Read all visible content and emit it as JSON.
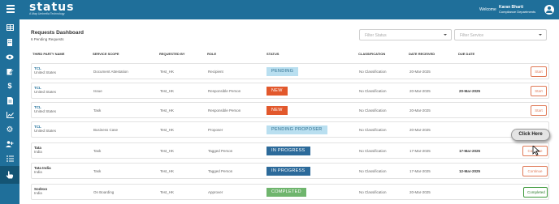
{
  "header": {
    "logo": "status",
    "logo_sub": "A Map Umbrella Technology",
    "welcome": "Welcome",
    "user_name": "Karan Bharti",
    "user_dept": "Compliance Departments"
  },
  "sidebar": {
    "items": [
      {
        "icon": "table-icon"
      },
      {
        "icon": "building-icon"
      },
      {
        "icon": "eye-icon"
      },
      {
        "icon": "edit-document-icon"
      },
      {
        "icon": "dollar-icon"
      },
      {
        "icon": "file-icon"
      },
      {
        "icon": "chart-icon"
      },
      {
        "icon": "gear-icon"
      },
      {
        "icon": "user-add-icon"
      },
      {
        "icon": "list-icon"
      },
      {
        "icon": "hand-pointer-icon"
      }
    ]
  },
  "page": {
    "title": "Requests Dashboard",
    "subtitle": "6 Pending Requests"
  },
  "filters": {
    "status_placeholder": "Filter Status",
    "service_placeholder": "Filter Service"
  },
  "table": {
    "headers": [
      "THIRD PARTY NAME",
      "SERVICE SCOPE",
      "REQUESTED BY",
      "ROLE",
      "STATUS",
      "CLASSIFICATION",
      "DATE RECEIVED",
      "DUE DATE"
    ],
    "rows": [
      {
        "name": "TCL",
        "country": "United States",
        "scope": "Document Attestation",
        "requested_by": "Test_HK",
        "role": "Recipient",
        "status": "PENDING",
        "classification": "No Classification",
        "received": "20-Mar-2025",
        "due": "",
        "action": "Start"
      },
      {
        "name": "TCL",
        "country": "United States",
        "scope": "Issue",
        "requested_by": "Test_HK",
        "role": "Responsible Person",
        "status": "NEW",
        "classification": "No Classification",
        "received": "20-Mar-2025",
        "due": "20-Mar-2025",
        "action": "Start"
      },
      {
        "name": "TCL",
        "country": "United States",
        "scope": "Task",
        "requested_by": "Test_HK",
        "role": "Responsible Person",
        "status": "NEW",
        "classification": "No Classification",
        "received": "20-Mar-2025",
        "due": "",
        "action": "Start"
      },
      {
        "name": "TCL",
        "country": "United States",
        "scope": "Business Case",
        "requested_by": "Test_HK",
        "role": "Proposer",
        "status": "PENDING PROPOSER",
        "classification": "No Classification",
        "received": "20-Mar-2025",
        "due": "",
        "action": ""
      },
      {
        "name": "Tata",
        "country": "India",
        "scope": "Task",
        "requested_by": "Test_HK",
        "role": "Tagged Person",
        "status": "IN PROGRESS",
        "classification": "No Classification",
        "received": "17-Mar-2025",
        "due": "17-Mar-2025",
        "action": "Continue"
      },
      {
        "name": "Tata India",
        "country": "India",
        "scope": "Task",
        "requested_by": "Test_HK",
        "role": "Tagged Person",
        "status": "IN PROGRESS",
        "classification": "No Classification",
        "received": "17-Mar-2025",
        "due": "12-Mar-2025",
        "action": "Continue"
      },
      {
        "name": "Sodexo",
        "country": "India",
        "scope": "On Boarding",
        "requested_by": "Test_HK",
        "role": "Approver",
        "status": "COMPLETED",
        "classification": "No Classification",
        "received": "20-Mar-2025",
        "due": "",
        "action": "Completed"
      }
    ]
  },
  "tooltip": {
    "label": "Click Here"
  },
  "colors": {
    "brand": "#1f6f9a",
    "pending": "#b9dff0",
    "new": "#e2582c",
    "in_progress": "#2c6a9a",
    "completed": "#6fb56d"
  }
}
